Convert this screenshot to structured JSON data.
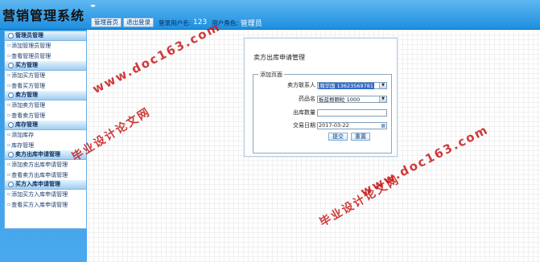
{
  "app": {
    "title": "营销管理系统",
    "collapse_glyph": "◂▸"
  },
  "topbar": {
    "home_label": "管理首页",
    "logout_label": "退出登录",
    "username_label": "登录用户名:",
    "username": "123",
    "role_label": "用户角色:",
    "role": "管理员"
  },
  "sidebar": {
    "groups": [
      {
        "title": "管理员管理",
        "items": [
          "添加管理员管理",
          "查看管理员管理"
        ]
      },
      {
        "title": "买方管理",
        "items": [
          "添加买方管理",
          "查看买方管理"
        ]
      },
      {
        "title": "卖方管理",
        "items": [
          "添加卖方管理",
          "查看卖方管理"
        ]
      },
      {
        "title": "库存管理",
        "items": [
          "添加库存",
          "库存管理"
        ]
      },
      {
        "title": "卖方出库申请管理",
        "items": [
          "添加卖方出库申请管理",
          "查看卖方出库申请管理"
        ]
      },
      {
        "title": "买方入库申请管理",
        "items": [
          "添加买方入库申请管理",
          "查看买方入库申请管理"
        ]
      }
    ]
  },
  "form": {
    "page_title": "卖方出库申请管理",
    "legend": "添加页面",
    "seller_label": "卖方联系人",
    "seller_value": "周华国 13623569781",
    "drug_label": "药品名",
    "drug_value": "板蓝根颗粒 1000",
    "qty_label": "出库数量",
    "qty_value": "",
    "date_label": "交易日期",
    "date_value": "2017-03-22",
    "submit_label": "提交",
    "reset_label": "重置"
  },
  "watermarks": {
    "url": "www.doc163.com",
    "name": "毕业设计论文网"
  },
  "colors": {
    "header_top": "#5fb7f0",
    "header_bottom": "#1e8fe0",
    "watermark": "#c81818",
    "selection": "#316ac5"
  }
}
